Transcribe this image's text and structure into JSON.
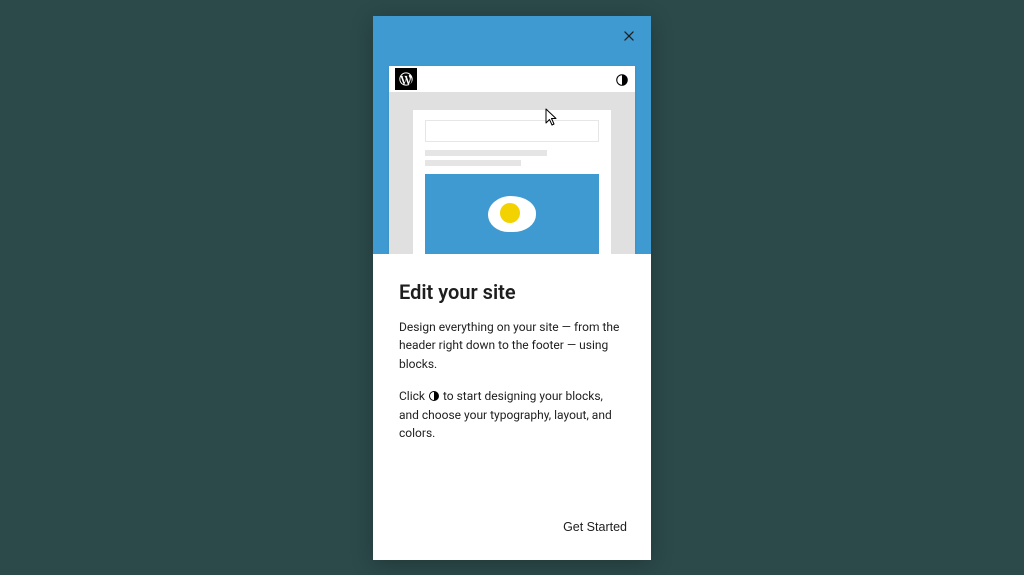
{
  "modal": {
    "title": "Edit your site",
    "paragraph1": "Design everything on your site — from the header right down to the footer — using blocks.",
    "paragraph2_a": "Click ",
    "paragraph2_b": " to start designing your blocks, and choose your typography, layout, and colors.",
    "cta": "Get Started"
  }
}
